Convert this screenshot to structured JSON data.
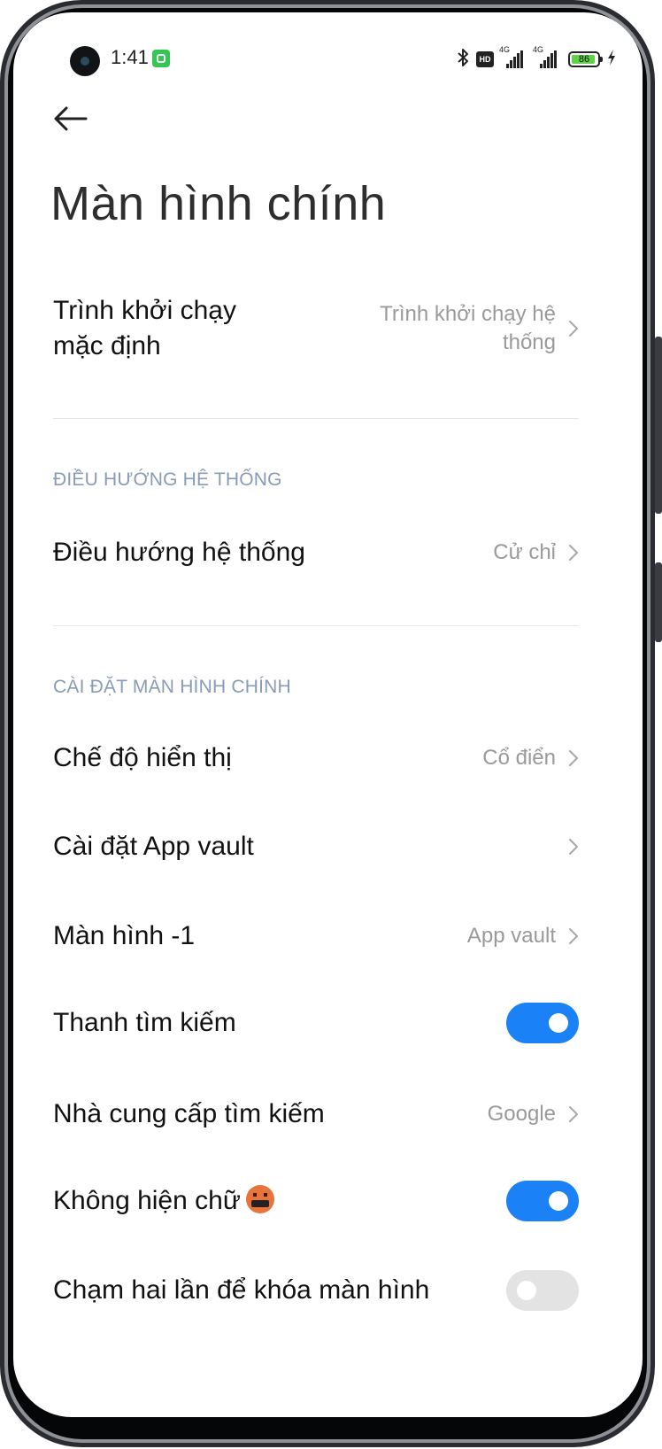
{
  "status_bar": {
    "time": "1:41",
    "hd_badge": "HD",
    "network_1": "4G",
    "network_2": "4G",
    "battery_level": "86",
    "icons": [
      "camera-cutout",
      "notification-app-icon",
      "bluetooth-icon",
      "hd-icon",
      "signal-icon",
      "signal-icon",
      "battery-icon",
      "charging-bolt-icon"
    ]
  },
  "header": {
    "back_icon": "back-arrow-icon",
    "title": "Màn hình chính"
  },
  "rows": {
    "launcher": {
      "label_line1": "Trình khởi chạy",
      "label_line2": "mặc định",
      "value_line1": "Trình khởi chạy hệ",
      "value_line2": "thống"
    },
    "navigation": {
      "label": "Điều hướng hệ thống",
      "value": "Cử chỉ"
    },
    "display_mode": {
      "label": "Chế độ hiển thị",
      "value": "Cổ điển"
    },
    "app_vault": {
      "label": "Cài đặt App vault"
    },
    "screen_minus_one": {
      "label": "Màn hình -1",
      "value": "App vault"
    },
    "search_bar": {
      "label": "Thanh tìm kiếm",
      "enabled": true
    },
    "search_provider": {
      "label": "Nhà cung cấp tìm kiếm",
      "value": "Google"
    },
    "hide_labels": {
      "label": "Không hiện chữ",
      "emoji": "🤬",
      "enabled": true
    },
    "double_tap_lock": {
      "label": "Chạm hai lần để khóa màn hình",
      "enabled": false
    }
  },
  "sections": {
    "navigation_header": "ĐIỀU HƯỚNG HỆ THỐNG",
    "home_settings_header": "CÀI ĐẶT MÀN HÌNH CHÍNH"
  },
  "colors": {
    "accent": "#1a82f6",
    "section_header": "#8a9bb6",
    "secondary_text": "#9a9a9a",
    "toggle_off": "#e3e3e3"
  }
}
